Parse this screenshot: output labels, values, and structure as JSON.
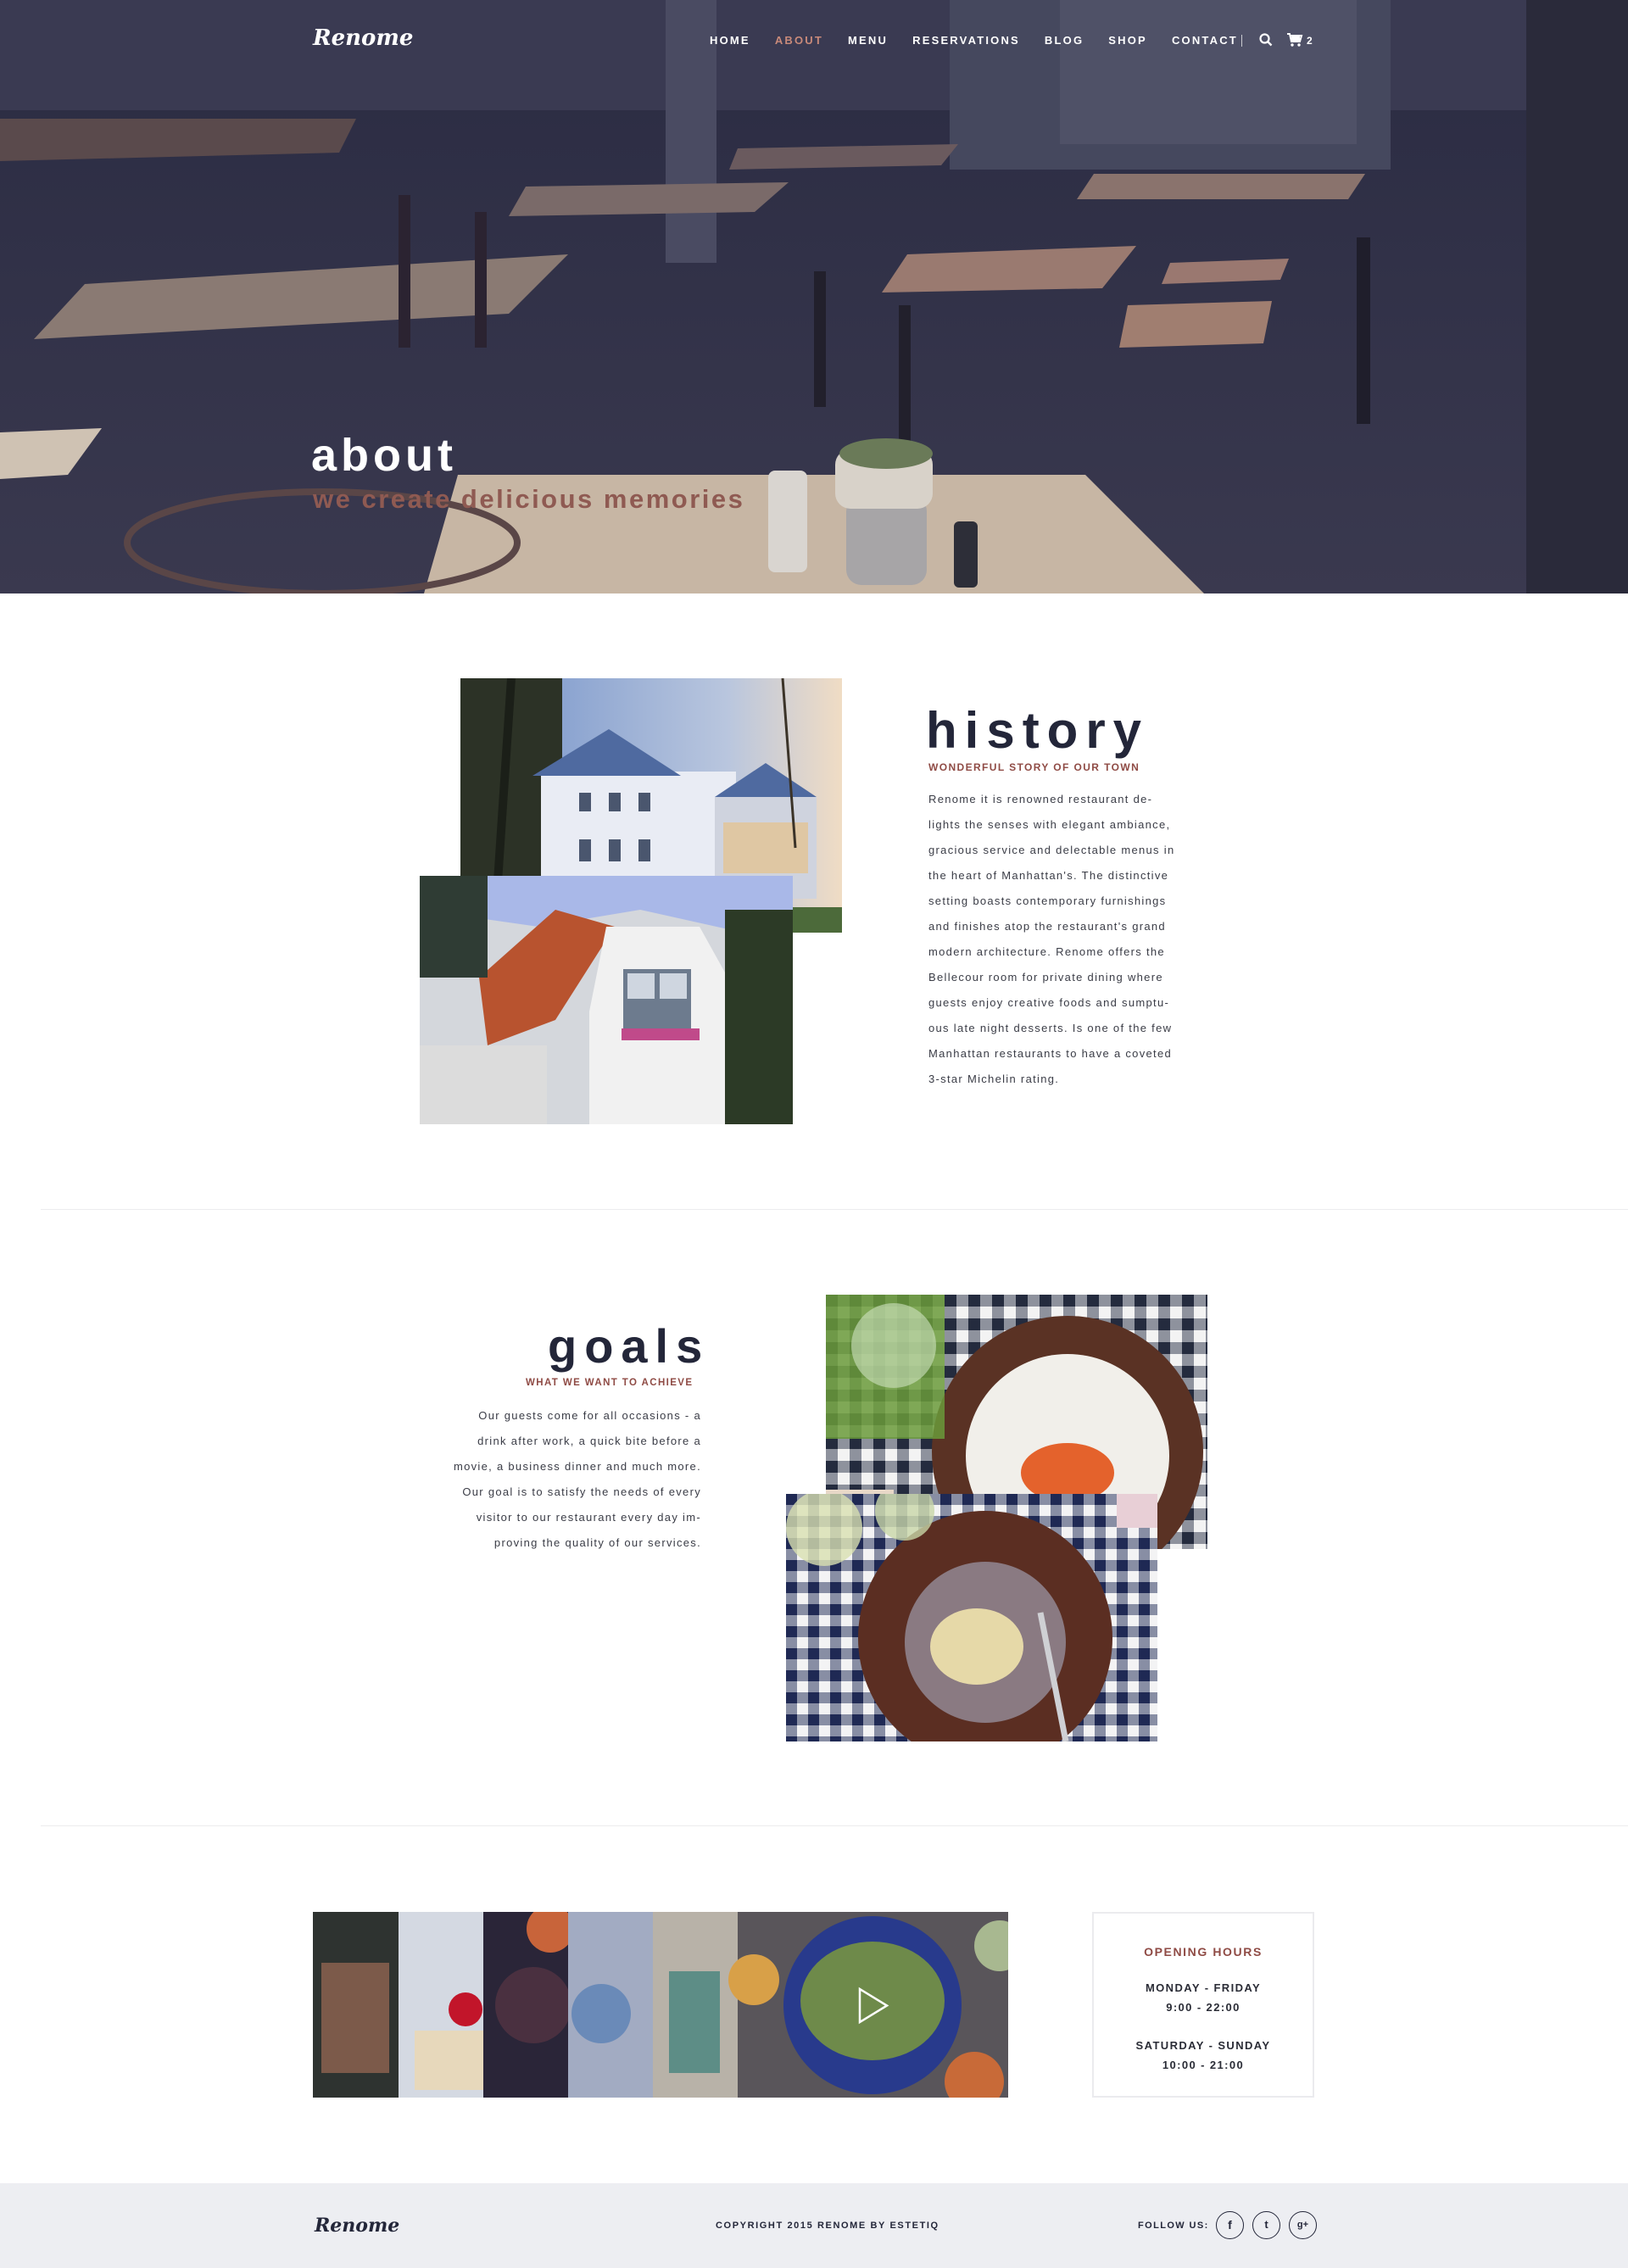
{
  "brand": {
    "logo": "Renome"
  },
  "nav": {
    "items": [
      {
        "label": "HOME",
        "active": false
      },
      {
        "label": "ABOUT",
        "active": true
      },
      {
        "label": "MENU",
        "active": false
      },
      {
        "label": "RESERVATIONS",
        "active": false
      },
      {
        "label": "BLOG",
        "active": false
      },
      {
        "label": "SHOP",
        "active": false
      },
      {
        "label": "CONTACT",
        "active": false
      }
    ],
    "search_icon": "search-icon",
    "cart_icon": "cart-icon",
    "cart_count": "2"
  },
  "hero": {
    "title": "about",
    "subtitle": "we create delicious memories"
  },
  "history": {
    "title": "history",
    "tagline": "WONDERFUL STORY OF OUR TOWN",
    "lines": [
      "Renome it is renowned restaurant de-",
      "lights the senses with elegant ambiance,",
      "gracious service and delectable menus in",
      "the heart of Manhattan's. The distinctive",
      "setting boasts contemporary furnishings",
      "and finishes atop the restaurant's grand",
      "modern architecture. Renome offers the",
      "Bellecour room for private dining where",
      "guests enjoy creative foods and sumptu-",
      "ous late night desserts. Is one of the few",
      "Manhattan restaurants to have a coveted",
      "3-star Michelin rating."
    ]
  },
  "goals": {
    "title": "goals",
    "tagline": "WHAT WE WANT TO ACHIEVE",
    "lines": [
      "Our guests come for all occasions - a",
      "drink after work, a quick bite before a",
      "movie, a business dinner and much more.",
      "Our goal is to satisfy the needs of every",
      "visitor to our restaurant every day im-",
      "proving the quality of our services."
    ]
  },
  "video": {
    "play_icon": "play-icon"
  },
  "hours": {
    "title": "OPENING HOURS",
    "weekday_label": "MONDAY - FRIDAY",
    "weekday_time": "9:00 - 22:00",
    "weekend_label": "SATURDAY - SUNDAY",
    "weekend_time": "10:00 - 21:00"
  },
  "footer": {
    "logo": "Renome",
    "copyright": "COPYRIGHT 2015 RENOME BY ESTETIQ",
    "follow_label": "FOLLOW US:",
    "social": [
      {
        "icon": "facebook-icon",
        "glyph": "f"
      },
      {
        "icon": "twitter-icon",
        "glyph": "t"
      },
      {
        "icon": "google-plus-icon",
        "glyph": "g+"
      }
    ]
  }
}
